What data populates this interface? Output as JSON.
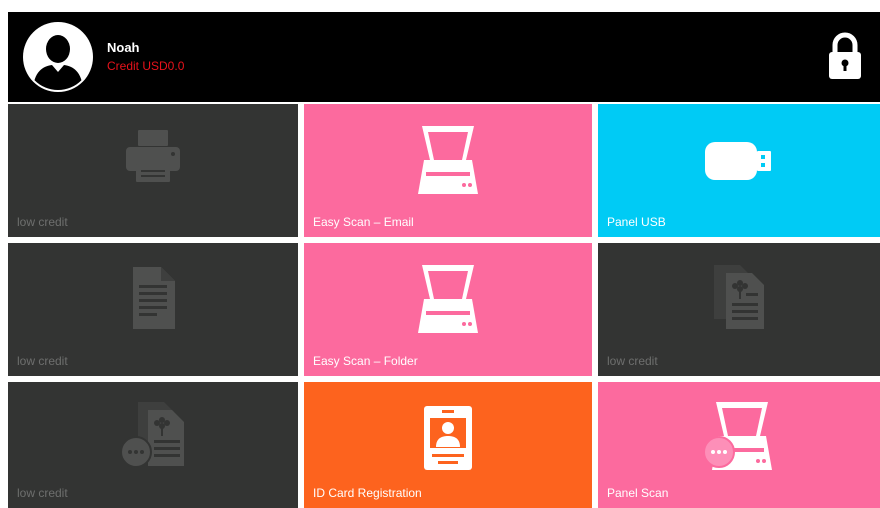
{
  "header": {
    "user_name": "Noah",
    "credit_text": "Credit USD0.0",
    "avatar_icon": "user-avatar-icon",
    "lock_icon": "lock-icon",
    "dropdown_icon": "chevron-down-icon"
  },
  "colors": {
    "header_bg": "#000000",
    "credit_text": "#e8121b",
    "tile_disabled": "#333433",
    "tile_pink": "#fc6a9e",
    "tile_cyan": "#00cbf5",
    "tile_orange": "#fd631e",
    "dropdown_tab": "#f0a92c"
  },
  "tiles": [
    {
      "label": "low credit",
      "icon": "printer-icon",
      "state": "disabled"
    },
    {
      "label": "Easy Scan – Email",
      "icon": "scanner-icon",
      "state": "enabled"
    },
    {
      "label": "Panel USB",
      "icon": "usb-drive-icon",
      "state": "enabled"
    },
    {
      "label": "low credit",
      "icon": "document-icon",
      "state": "disabled"
    },
    {
      "label": "Easy Scan – Folder",
      "icon": "scanner-icon",
      "state": "enabled"
    },
    {
      "label": "low credit",
      "icon": "copy-documents-icon",
      "state": "disabled"
    },
    {
      "label": "low credit",
      "icon": "copy-documents-more-icon",
      "state": "disabled"
    },
    {
      "label": "ID Card Registration",
      "icon": "id-card-icon",
      "state": "enabled"
    },
    {
      "label": "Panel Scan",
      "icon": "scanner-more-icon",
      "state": "enabled"
    }
  ]
}
